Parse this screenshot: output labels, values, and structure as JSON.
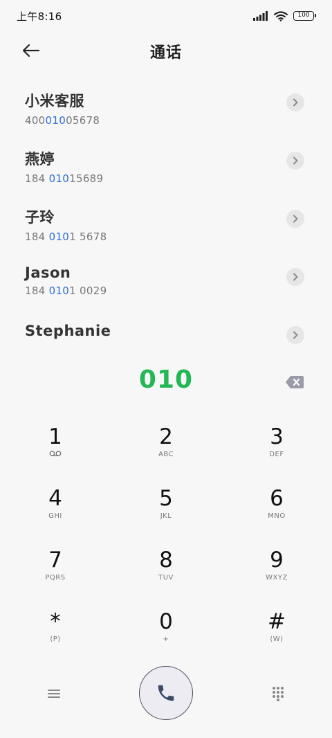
{
  "status_bar": {
    "time": "上午8:16",
    "battery": "100",
    "icons": [
      "signal-icon",
      "wifi-icon",
      "battery-icon"
    ]
  },
  "header": {
    "title": "通话",
    "back_icon": "back-arrow-icon"
  },
  "contacts": [
    {
      "name": "小米客服",
      "number_pre": "400",
      "number_match": "010",
      "number_post": "05678"
    },
    {
      "name": "燕婷",
      "number_pre": "184 ",
      "number_match": "010",
      "number_post": "15689"
    },
    {
      "name": "子玲",
      "number_pre": "184 ",
      "number_match": "010",
      "number_post": "1 5678"
    },
    {
      "name": "Jason",
      "number_pre": "184 ",
      "number_match": "010",
      "number_post": "1 0029"
    },
    {
      "name": "Stephanie",
      "number_pre": "",
      "number_match": "",
      "number_post": ""
    }
  ],
  "dialer": {
    "input": "010",
    "input_color": "#23b755",
    "highlight_color": "#2f6fd6"
  },
  "keypad": [
    {
      "digit": "1",
      "letters": ""
    },
    {
      "digit": "2",
      "letters": "ABC"
    },
    {
      "digit": "3",
      "letters": "DEF"
    },
    {
      "digit": "4",
      "letters": "GHI"
    },
    {
      "digit": "5",
      "letters": "JKL"
    },
    {
      "digit": "6",
      "letters": "MNO"
    },
    {
      "digit": "7",
      "letters": "PQRS"
    },
    {
      "digit": "8",
      "letters": "TUV"
    },
    {
      "digit": "9",
      "letters": "WXYZ"
    },
    {
      "digit": "*",
      "letters": "(P)"
    },
    {
      "digit": "0",
      "letters": "+"
    },
    {
      "digit": "#",
      "letters": "(W)"
    }
  ],
  "bottom_bar": {
    "icons": [
      "menu-icon",
      "phone-icon",
      "dialpad-icon"
    ]
  }
}
